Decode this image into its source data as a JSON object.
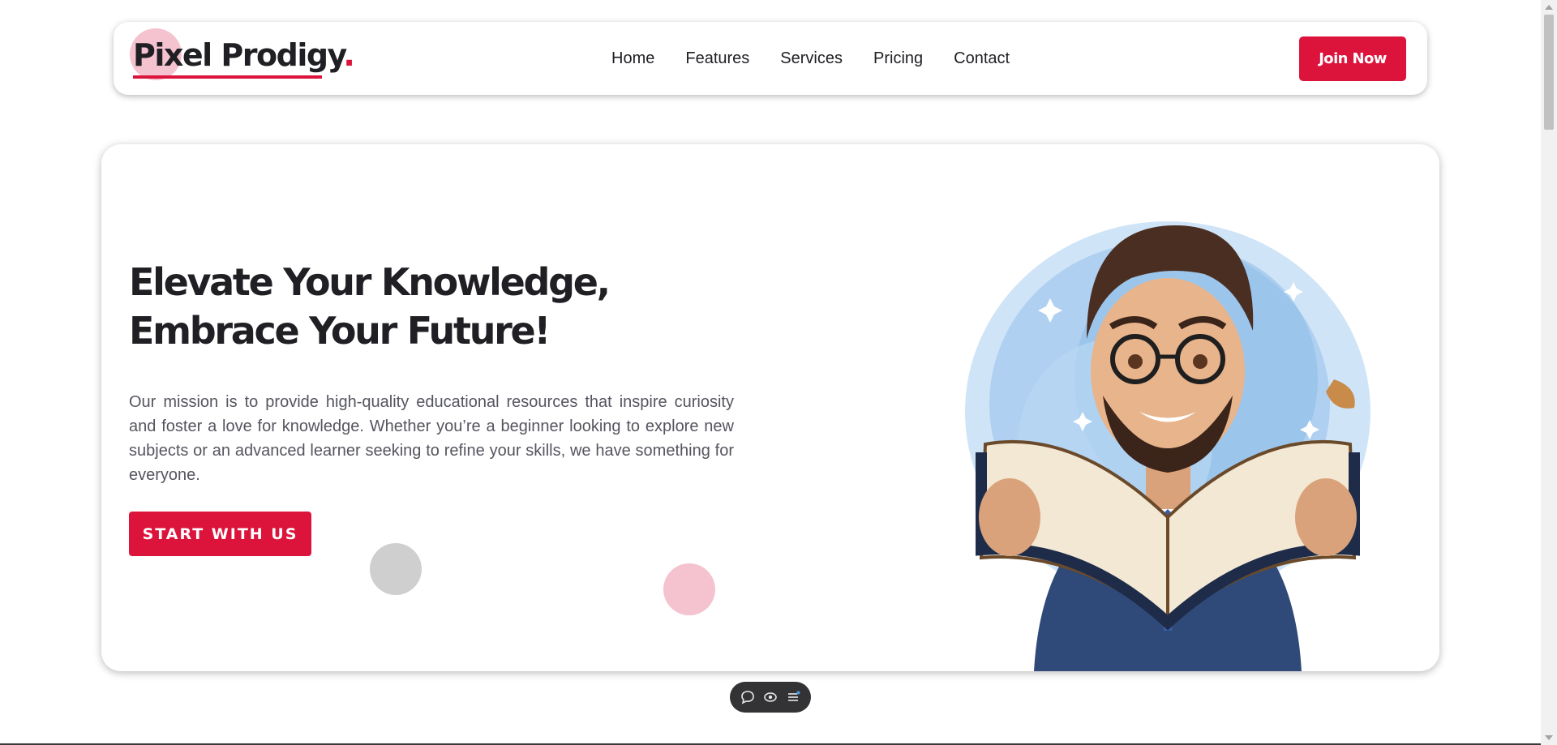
{
  "header": {
    "logo_text": "Pixel Prodigy",
    "logo_dot": ".",
    "nav": [
      "Home",
      "Features",
      "Services",
      "Pricing",
      "Contact"
    ],
    "join_label": "Join Now"
  },
  "hero": {
    "title": "Elevate Your Knowledge, Embrace Your Future!",
    "description": "Our mission is to provide high-quality educational resources that inspire curiosity and foster a love for knowledge. Whether you’re a beginner looking to explore new subjects or an advanced learner seeking to refine your skills, we have something for everyone.",
    "cta_label": "START WITH US",
    "illustration": "teacher-reading-book-illustration"
  },
  "toolbar": {
    "icons": [
      "comment-icon",
      "eye-toggle-icon",
      "menu-list-icon"
    ]
  },
  "colors": {
    "accent": "#dc143c",
    "accent_light": "#f5c2cf",
    "text_dark": "#1f1f24",
    "text_body": "#55555f",
    "decor_gray": "#cfcfcf",
    "toolbar_bg": "#333336"
  }
}
